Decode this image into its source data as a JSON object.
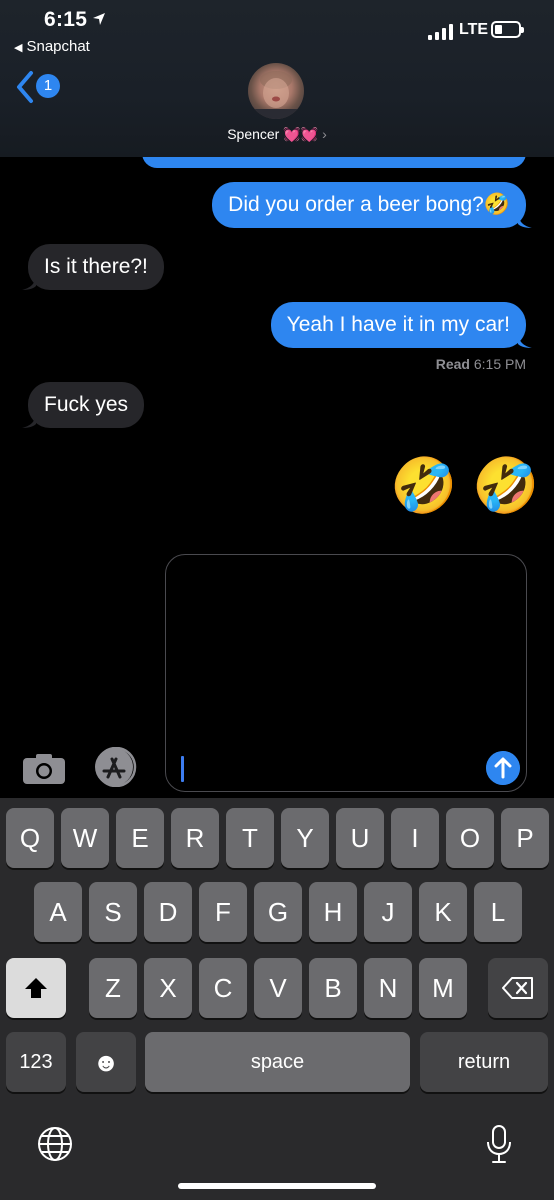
{
  "status_bar": {
    "time": "6:15",
    "back_app": "Snapchat",
    "network": "LTE"
  },
  "header": {
    "badge": "1",
    "contact_name": "Spencer 💓💓",
    "chevron": "›"
  },
  "messages": [
    {
      "dir": "out",
      "text": "Did you order a beer bong?🤣"
    },
    {
      "dir": "in",
      "text": "Is it there?!"
    },
    {
      "dir": "out",
      "text": "Yeah I have it in my car!"
    },
    {
      "dir": "in",
      "text": "Fuck yes"
    },
    {
      "dir": "out",
      "text": "🤣 🤣"
    }
  ],
  "read_receipt": {
    "label": "Read",
    "time": "6:15 PM"
  },
  "keyboard": {
    "row1": [
      "Q",
      "W",
      "E",
      "R",
      "T",
      "Y",
      "U",
      "I",
      "O",
      "P"
    ],
    "row2": [
      "A",
      "S",
      "D",
      "F",
      "G",
      "H",
      "J",
      "K",
      "L"
    ],
    "row3": [
      "Z",
      "X",
      "C",
      "V",
      "B",
      "N",
      "M"
    ],
    "numbers_key": "123",
    "emoji_key": "☻",
    "space_key": "space",
    "return_key": "return"
  },
  "colors": {
    "accent": "#2e86f0",
    "incoming_bubble": "#26262a",
    "keyboard_bg": "#2a2a2c"
  },
  "icons": [
    "location-arrow-icon",
    "back-chevron-icon",
    "camera-icon",
    "app-store-icon",
    "send-arrow-icon",
    "shift-icon",
    "delete-icon",
    "globe-icon",
    "mic-icon"
  ]
}
